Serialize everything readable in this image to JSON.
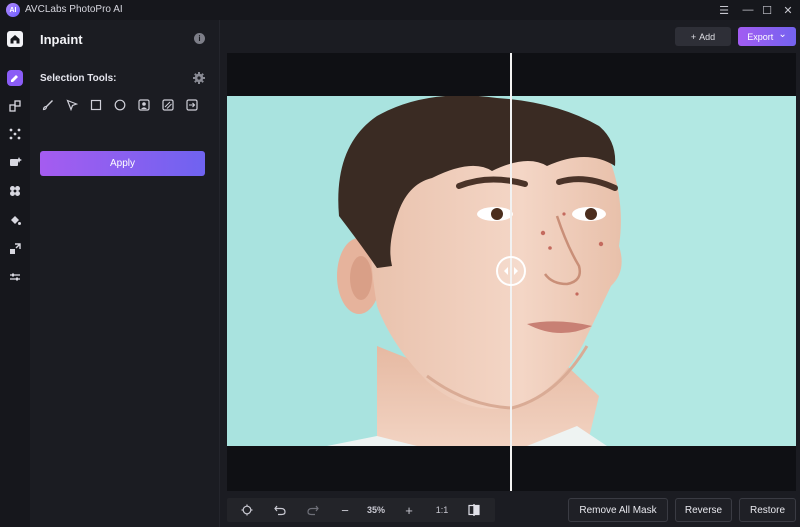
{
  "app": {
    "title": "AVCLabs PhotoPro AI",
    "logo_text": "AI",
    "accent_color": "#8a5cf6"
  },
  "window_controls": {
    "menu_icon": "☰",
    "minimize_icon": "—",
    "maximize_icon": "☐",
    "close_icon": "✕"
  },
  "rail": {
    "items": [
      {
        "name": "home-icon"
      },
      {
        "name": "inpaint-icon"
      },
      {
        "name": "enhance-icon"
      },
      {
        "name": "denoise-icon"
      },
      {
        "name": "face-retouch-icon"
      },
      {
        "name": "background-icon"
      },
      {
        "name": "colorize-icon"
      },
      {
        "name": "upscale-icon"
      },
      {
        "name": "adjust-icon"
      }
    ]
  },
  "panel": {
    "title": "Inpaint",
    "info_icon": "i",
    "selection_tools_label": "Selection Tools:",
    "tools": [
      {
        "name": "brush-tool-icon"
      },
      {
        "name": "lasso-tool-icon"
      },
      {
        "name": "rectangle-tool-icon"
      },
      {
        "name": "ellipse-tool-icon"
      },
      {
        "name": "portrait-select-icon"
      },
      {
        "name": "pattern-select-icon"
      },
      {
        "name": "import-mask-icon"
      }
    ],
    "apply_label": "Apply"
  },
  "topbar": {
    "add_label": "Add",
    "add_icon": "+",
    "export_label": "Export",
    "export_icon": "⌄"
  },
  "bottom": {
    "zoom": "35%",
    "ratio_label": "1:1",
    "zoom_out_icon": "−",
    "zoom_in_icon": "+",
    "remove_all_mask_label": "Remove All Mask",
    "reverse_label": "Reverse",
    "restore_label": "Restore"
  }
}
